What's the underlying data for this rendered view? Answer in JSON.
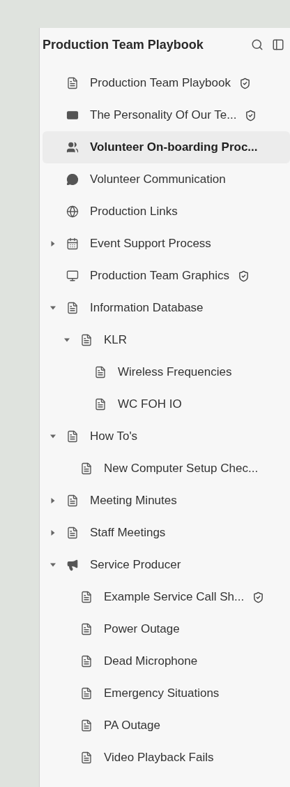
{
  "sidebar": {
    "title": "Production Team Playbook",
    "items": [
      {
        "kind": "doc",
        "label": "Production Team Playbook",
        "shield": true,
        "selected": false
      },
      {
        "kind": "idcard",
        "label": "The Personality Of Our Te...",
        "shield": true,
        "selected": false
      },
      {
        "kind": "users",
        "label": "Volunteer On-boarding Proc...",
        "shield": false,
        "selected": true
      },
      {
        "kind": "chat",
        "label": "Volunteer Communication",
        "shield": false,
        "selected": false
      },
      {
        "kind": "globe",
        "label": "Production Links",
        "shield": false,
        "selected": false
      },
      {
        "kind": "calendar",
        "label": "Event Support Process",
        "shield": false,
        "selected": false,
        "expanded": false
      },
      {
        "kind": "monitor",
        "label": "Production Team Graphics",
        "shield": true,
        "selected": false
      },
      {
        "kind": "doc",
        "label": "Information Database",
        "shield": false,
        "selected": false,
        "expanded": true,
        "children": [
          {
            "kind": "doc",
            "label": "KLR",
            "shield": false,
            "selected": false,
            "expanded": true,
            "children": [
              {
                "kind": "doc",
                "label": "Wireless Frequencies",
                "shield": false,
                "selected": false
              },
              {
                "kind": "doc",
                "label": "WC FOH IO",
                "shield": false,
                "selected": false
              }
            ]
          }
        ]
      },
      {
        "kind": "doc",
        "label": "How To's",
        "shield": false,
        "selected": false,
        "expanded": true,
        "children": [
          {
            "kind": "doc",
            "label": "New Computer Setup Chec...",
            "shield": false,
            "selected": false
          }
        ]
      },
      {
        "kind": "doc",
        "label": "Meeting Minutes",
        "shield": false,
        "selected": false,
        "expanded": false
      },
      {
        "kind": "doc",
        "label": "Staff Meetings",
        "shield": false,
        "selected": false,
        "expanded": false
      },
      {
        "kind": "megaphone",
        "label": "Service Producer",
        "shield": false,
        "selected": false,
        "expanded": true,
        "children": [
          {
            "kind": "doc",
            "label": "Example Service Call Sh...",
            "shield": true,
            "selected": false
          },
          {
            "kind": "doc",
            "label": "Power Outage",
            "shield": false,
            "selected": false
          },
          {
            "kind": "doc",
            "label": "Dead Microphone",
            "shield": false,
            "selected": false
          },
          {
            "kind": "doc",
            "label": "Emergency Situations",
            "shield": false,
            "selected": false
          },
          {
            "kind": "doc",
            "label": "PA Outage",
            "shield": false,
            "selected": false
          },
          {
            "kind": "doc",
            "label": "Video Playback Fails",
            "shield": false,
            "selected": false
          }
        ]
      }
    ]
  }
}
